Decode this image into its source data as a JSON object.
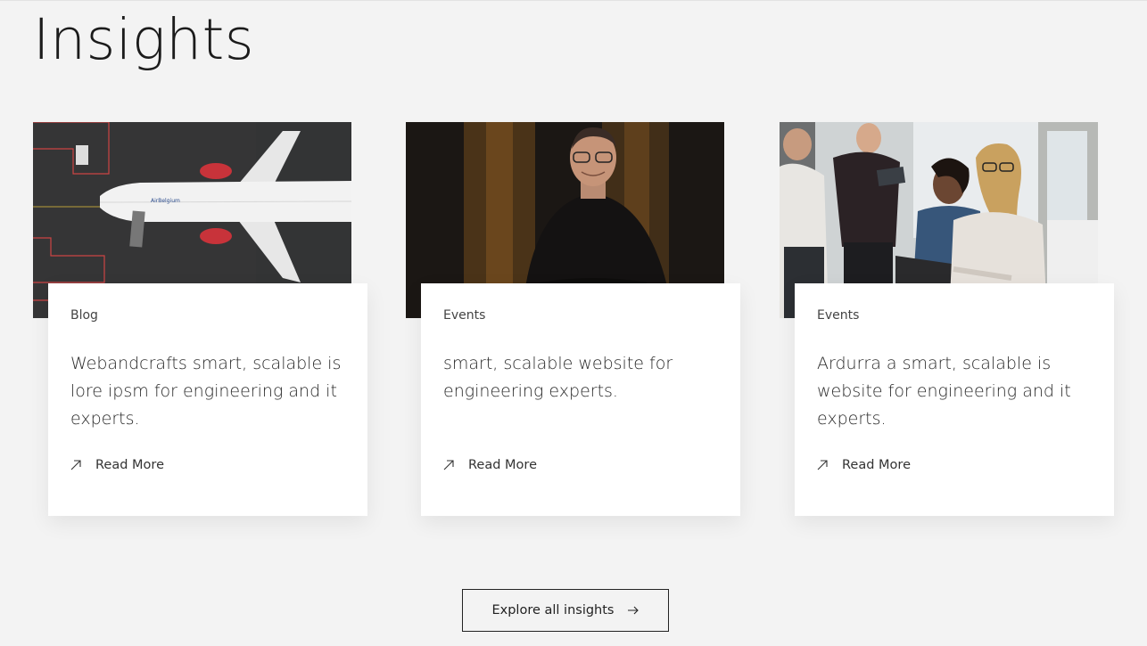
{
  "section": {
    "title": "Insights"
  },
  "cards": [
    {
      "tag": "Blog",
      "title": "Webandcrafts smart, scalable is lore ipsm for engineering and it experts.",
      "link_label": "Read More",
      "image": "airplane-aerial-photo"
    },
    {
      "tag": "Events",
      "title": "smart, scalable website for engineering experts.",
      "link_label": "Read More",
      "image": "man-portrait-photo"
    },
    {
      "tag": "Events",
      "title": "Ardurra a smart, scalable is website for engineering and it experts.",
      "link_label": "Read More",
      "image": "team-meeting-photo"
    }
  ],
  "cta": {
    "label": "Explore all insights"
  },
  "colors": {
    "background": "#f3f3f3",
    "card": "#ffffff",
    "text": "#222222"
  }
}
